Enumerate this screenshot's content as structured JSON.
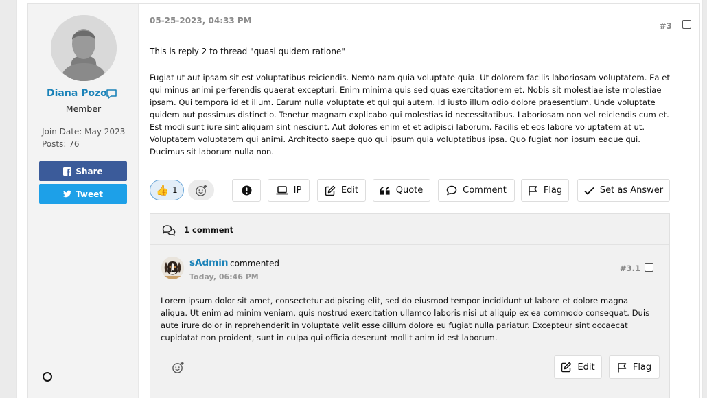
{
  "author": {
    "name": "Diana Pozo",
    "role": "Member",
    "join_date": "Join Date: May 2023",
    "posts": "Posts: 76",
    "share_label": "Share",
    "tweet_label": "Tweet"
  },
  "post": {
    "date": "05-25-2023, 04:33 PM",
    "number": "#3",
    "title": "This is reply 2 to thread \"quasi quidem ratione\"",
    "body": "Fugiat ut aut ipsam sit est voluptatibus reiciendis. Nemo nam quia voluptate quia. Ut dolorem facilis laboriosam voluptatem. Ea et qui minus animi perferendis quaerat excepturi. Enim minima quis sed quas exercitationem et. Nobis sit molestiae iste molestiae ipsam. Qui tempora id et illum. Earum nulla voluptate et qui qui autem. Id iusto illum odio dolore praesentium. Unde voluptate quidem aut possimus distinctio. Tenetur magnam explicabo qui molestias id necessitatibus. Laboriosam non vel reiciendis cum et. Est modi sunt iure sint aliquam sint nesciunt. Aut dolores enim et et adipisci laborum. Facilis et eos labore voluptatem at ut. Voluptatem voluptatem qui animi. Architecto saepe quo qui ipsum quia voluptatibus ipsa. Quo fugiat non ipsum eaque qui. Ducimus sit laborum nulla non.",
    "like_count": "1"
  },
  "toolbar": {
    "ip_label": "IP",
    "edit_label": "Edit",
    "quote_label": "Quote",
    "comment_label": "Comment",
    "flag_label": "Flag",
    "answer_label": "Set as Answer"
  },
  "comments": {
    "count_label": "1 comment",
    "items": [
      {
        "author": "sAdmin",
        "verb": "commented",
        "date": "Today, 06:46 PM",
        "number": "#3.1",
        "body": "Lorem ipsum dolor sit amet, consectetur adipiscing elit, sed do eiusmod tempor incididunt ut labore et dolore magna aliqua. Ut enim ad minim veniam, quis nostrud exercitation ullamco laboris nisi ut aliquip ex ea commodo consequat. Duis aute irure dolor in reprehenderit in voluptate velit esse cillum dolore eu fugiat nulla pariatur. Excepteur sint occaecat cupidatat non proident, sunt in culpa qui officia deserunt mollit anim id est laborum.",
        "edit_label": "Edit",
        "flag_label": "Flag"
      }
    ]
  },
  "colors": {
    "link_blue": "#1a82b8",
    "facebook": "#3b5b9a",
    "twitter": "#1da0e8"
  }
}
